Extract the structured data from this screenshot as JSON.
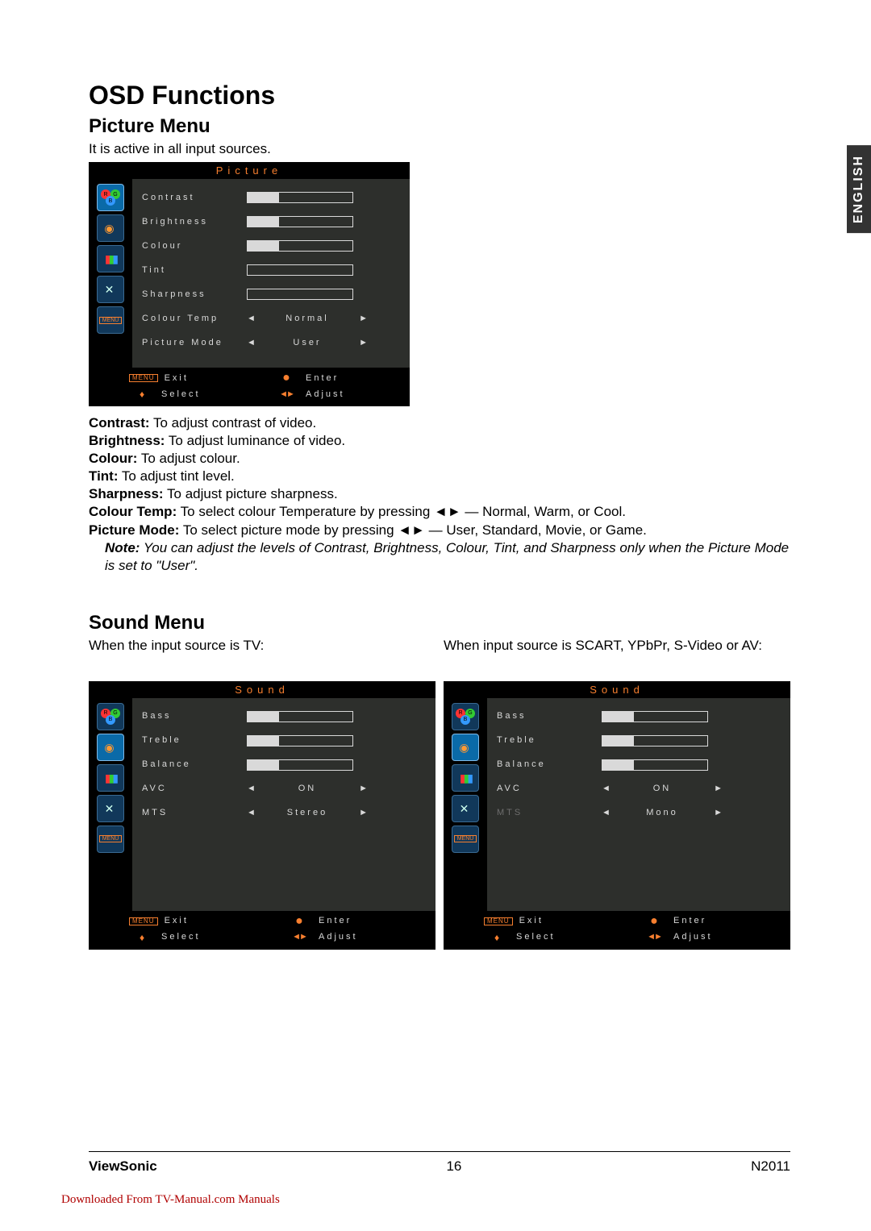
{
  "lang_tab": "ENGLISH",
  "title": "OSD Functions",
  "picture": {
    "heading": "Picture Menu",
    "intro": "It is active in all input sources.",
    "osd_title": "Picture",
    "rows": [
      {
        "label": "Contrast",
        "type": "slider",
        "fill": 30
      },
      {
        "label": "Brightness",
        "type": "slider",
        "fill": 30
      },
      {
        "label": "Colour",
        "type": "slider",
        "fill": 30
      },
      {
        "label": "Tint",
        "type": "slider",
        "fill": 0
      },
      {
        "label": "Sharpness",
        "type": "slider",
        "fill": 0
      },
      {
        "label": "Colour Temp",
        "type": "select",
        "value": "Normal"
      },
      {
        "label": "Picture Mode",
        "type": "select",
        "value": "User"
      }
    ]
  },
  "footer": {
    "exit": "Exit",
    "select": "Select",
    "enter": "Enter",
    "adjust": "Adjust",
    "menu": "MENU"
  },
  "definitions": {
    "contrast": {
      "term": "Contrast:",
      "text": " To adjust contrast of video."
    },
    "brightness": {
      "term": "Brightness:",
      "text": " To adjust luminance of video."
    },
    "colour": {
      "term": "Colour:",
      "text": " To adjust colour."
    },
    "tint": {
      "term": "Tint:",
      "text": " To adjust tint level."
    },
    "sharpness": {
      "term": "Sharpness:",
      "text": " To adjust picture sharpness."
    },
    "colourtemp": {
      "term": "Colour Temp:",
      "text": " To select colour Temperature by pressing ◄► — Normal, Warm, or Cool."
    },
    "picturemode": {
      "term": "Picture Mode:",
      "text": " To select picture mode by pressing ◄► — User, Standard, Movie, or Game."
    },
    "note": {
      "term": "Note:",
      "text": " You can adjust the levels of Contrast, Brightness, Colour, Tint, and Sharpness only when the Picture Mode is set to \"User\"."
    }
  },
  "sound": {
    "heading": "Sound Menu",
    "col1_intro": "When the input source is TV:",
    "col2_intro": "When input source is SCART, YPbPr, S-Video or AV:",
    "osd_title": "Sound",
    "rows_tv": [
      {
        "label": "Bass",
        "type": "slider",
        "fill": 30
      },
      {
        "label": "Treble",
        "type": "slider",
        "fill": 30
      },
      {
        "label": "Balance",
        "type": "slider",
        "fill": 30
      },
      {
        "label": "AVC",
        "type": "select",
        "value": "ON"
      },
      {
        "label": "MTS",
        "type": "select",
        "value": "Stereo"
      }
    ],
    "rows_av": [
      {
        "label": "Bass",
        "type": "slider",
        "fill": 30
      },
      {
        "label": "Treble",
        "type": "slider",
        "fill": 30
      },
      {
        "label": "Balance",
        "type": "slider",
        "fill": 30
      },
      {
        "label": "AVC",
        "type": "select",
        "value": "ON"
      },
      {
        "label": "MTS",
        "type": "select",
        "value": "Mono",
        "dim": true
      }
    ]
  },
  "page_footer": {
    "brand": "ViewSonic",
    "page": "16",
    "model": "N2011"
  },
  "download_link": "Downloaded From TV-Manual.com Manuals"
}
